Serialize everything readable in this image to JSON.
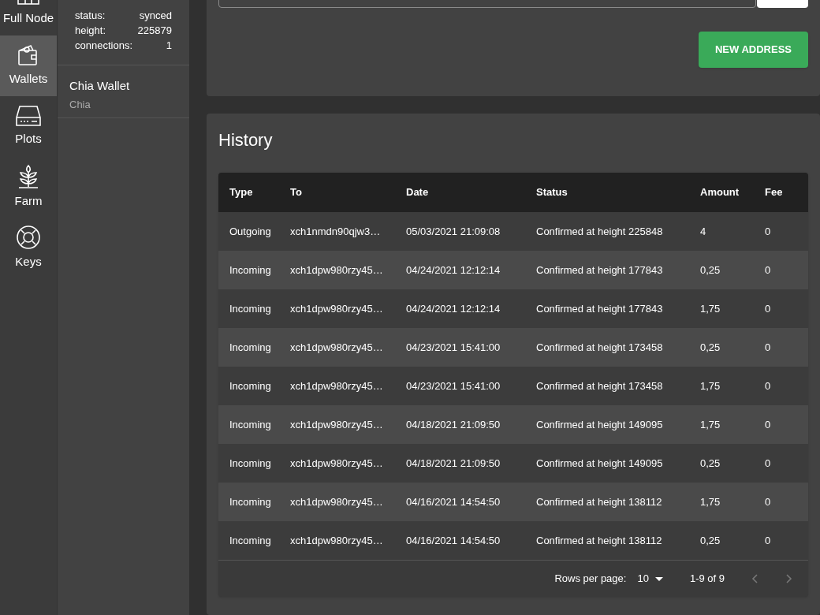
{
  "nav": [
    {
      "label": "Full Node",
      "selected": false
    },
    {
      "label": "Wallets",
      "selected": true
    },
    {
      "label": "Plots",
      "selected": false
    },
    {
      "label": "Farm",
      "selected": false
    },
    {
      "label": "Keys",
      "selected": false
    }
  ],
  "status": [
    {
      "label": "status:",
      "value": "synced"
    },
    {
      "label": "height:",
      "value": "225879"
    },
    {
      "label": "connections:",
      "value": "1"
    }
  ],
  "wallets": [
    {
      "name": "Chia Wallet",
      "type": "Chia",
      "selected": false
    }
  ],
  "new_address_button": "NEW ADDRESS",
  "history": {
    "title": "History",
    "columns": [
      "Type",
      "To",
      "Date",
      "Status",
      "Amount",
      "Fee"
    ],
    "rows": [
      [
        "Outgoing",
        "xch1nmdn90qjw3…",
        "05/03/2021 21:09:08",
        "Confirmed at height 225848",
        "4",
        "0"
      ],
      [
        "Incoming",
        "xch1dpw980rzy45…",
        "04/24/2021 12:12:14",
        "Confirmed at height 177843",
        "0,25",
        "0"
      ],
      [
        "Incoming",
        "xch1dpw980rzy45…",
        "04/24/2021 12:12:14",
        "Confirmed at height 177843",
        "1,75",
        "0"
      ],
      [
        "Incoming",
        "xch1dpw980rzy45…",
        "04/23/2021 15:41:00",
        "Confirmed at height 173458",
        "0,25",
        "0"
      ],
      [
        "Incoming",
        "xch1dpw980rzy45…",
        "04/23/2021 15:41:00",
        "Confirmed at height 173458",
        "1,75",
        "0"
      ],
      [
        "Incoming",
        "xch1dpw980rzy45…",
        "04/18/2021 21:09:50",
        "Confirmed at height 149095",
        "1,75",
        "0"
      ],
      [
        "Incoming",
        "xch1dpw980rzy45…",
        "04/18/2021 21:09:50",
        "Confirmed at height 149095",
        "0,25",
        "0"
      ],
      [
        "Incoming",
        "xch1dpw980rzy45…",
        "04/16/2021 14:54:50",
        "Confirmed at height 138112",
        "1,75",
        "0"
      ],
      [
        "Incoming",
        "xch1dpw980rzy45…",
        "04/16/2021 14:54:50",
        "Confirmed at height 138112",
        "0,25",
        "0"
      ]
    ],
    "rows_per_page_label": "Rows per page:",
    "rows_per_page": "10",
    "range": "1-9 of 9"
  }
}
